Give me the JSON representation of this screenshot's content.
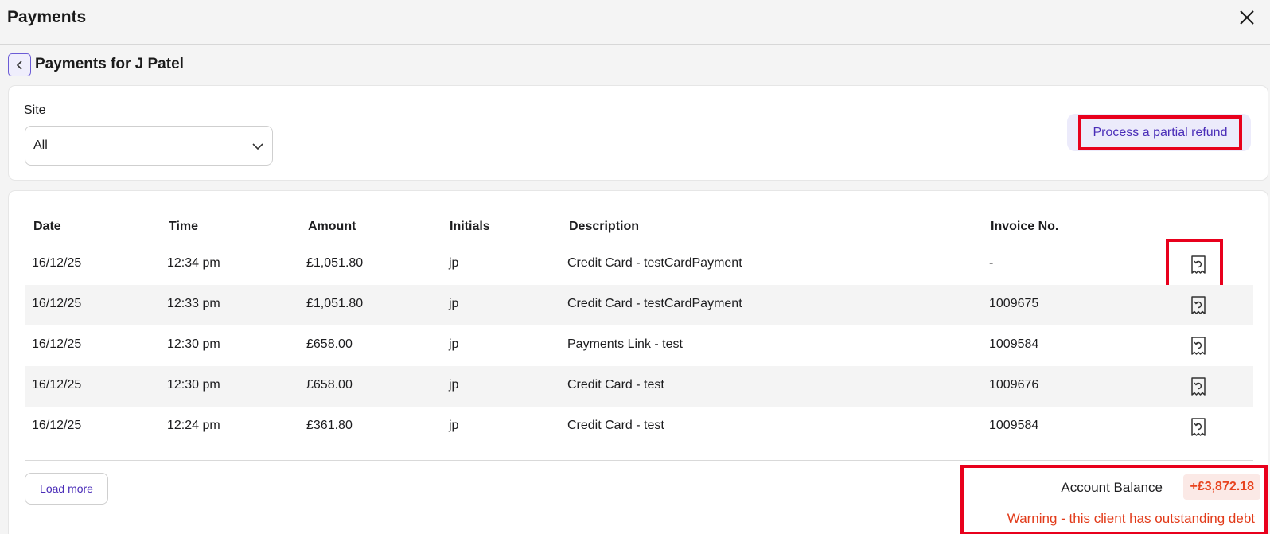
{
  "window": {
    "title": "Payments",
    "close_icon": "close-icon"
  },
  "subheader": {
    "back_icon": "chevron-left-icon",
    "title": "Payments for J Patel"
  },
  "filters": {
    "site_label": "Site",
    "site_value": "All",
    "site_chevron_icon": "chevron-down-icon",
    "refund_button_label": "Process a partial refund"
  },
  "table": {
    "headers": [
      "Date",
      "Time",
      "Amount",
      "Initials",
      "Description",
      "Invoice No."
    ],
    "rows": [
      {
        "date": "16/12/25",
        "time": "12:34 pm",
        "amount": "£1,051.80",
        "initials": "jp",
        "description": "Credit Card - testCardPayment",
        "invoice": "-",
        "action_icon": "receipt-refund-icon"
      },
      {
        "date": "16/12/25",
        "time": "12:33 pm",
        "amount": "£1,051.80",
        "initials": "jp",
        "description": "Credit Card - testCardPayment",
        "invoice": "1009675",
        "action_icon": "receipt-refund-icon"
      },
      {
        "date": "16/12/25",
        "time": "12:30 pm",
        "amount": "£658.00",
        "initials": "jp",
        "description": "Payments Link - test",
        "invoice": "1009584",
        "action_icon": "receipt-refund-icon"
      },
      {
        "date": "16/12/25",
        "time": "12:30 pm",
        "amount": "£658.00",
        "initials": "jp",
        "description": "Credit Card - test",
        "invoice": "1009676",
        "action_icon": "receipt-refund-icon"
      },
      {
        "date": "16/12/25",
        "time": "12:24 pm",
        "amount": "£361.80",
        "initials": "jp",
        "description": "Credit Card - test",
        "invoice": "1009584",
        "action_icon": "receipt-refund-icon"
      }
    ]
  },
  "footer": {
    "load_more_label": "Load more",
    "balance_label": "Account Balance",
    "balance_value": "+£3,872.18",
    "warning": "Warning - this client has outstanding debt"
  },
  "colors": {
    "accent": "#4a2db8",
    "highlight": "#e8001c",
    "debt": "#e8441f"
  }
}
